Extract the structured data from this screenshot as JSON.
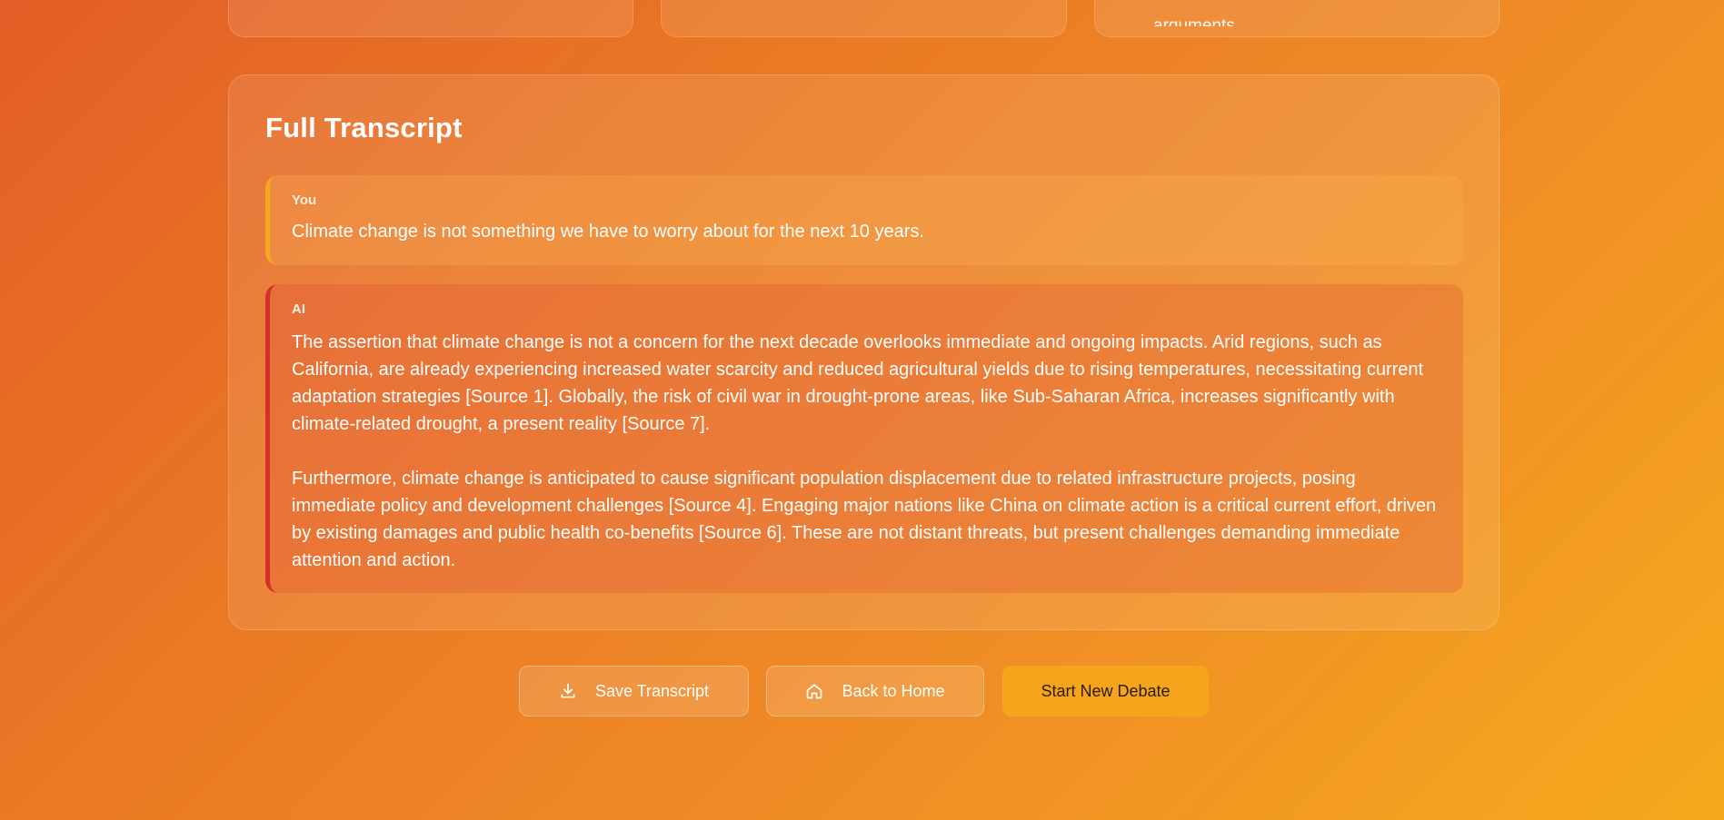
{
  "top_cards": [
    {
      "text": ""
    },
    {
      "text": ""
    },
    {
      "text": "arguments."
    }
  ],
  "transcript": {
    "title": "Full Transcript",
    "messages": [
      {
        "role": "You",
        "paragraphs": [
          "Climate change is not something we have to worry about for the next 10 years."
        ]
      },
      {
        "role": "AI",
        "paragraphs": [
          "The assertion that climate change is not a concern for the next decade overlooks immediate and ongoing impacts. Arid regions, such as California, are already experiencing increased water scarcity and reduced agricultural yields due to rising temperatures, necessitating current adaptation strategies [Source 1]. Globally, the risk of civil war in drought-prone areas, like Sub-Saharan Africa, increases significantly with climate-related drought, a present reality [Source 7].",
          "Furthermore, climate change is anticipated to cause significant population displacement due to related infrastructure projects, posing immediate policy and development challenges [Source 4]. Engaging major nations like China on climate action is a critical current effort, driven by existing damages and public health co-benefits [Source 6]. These are not distant threats, but present challenges demanding immediate attention and action."
        ]
      }
    ]
  },
  "actions": {
    "save_label": "Save Transcript",
    "save_icon": "download-icon",
    "home_label": "Back to Home",
    "home_icon": "home-icon",
    "new_label": "Start New Debate"
  },
  "colors": {
    "user_accent": "#f6a623",
    "ai_accent": "#d5302b",
    "primary_button": "#f4a51c"
  }
}
